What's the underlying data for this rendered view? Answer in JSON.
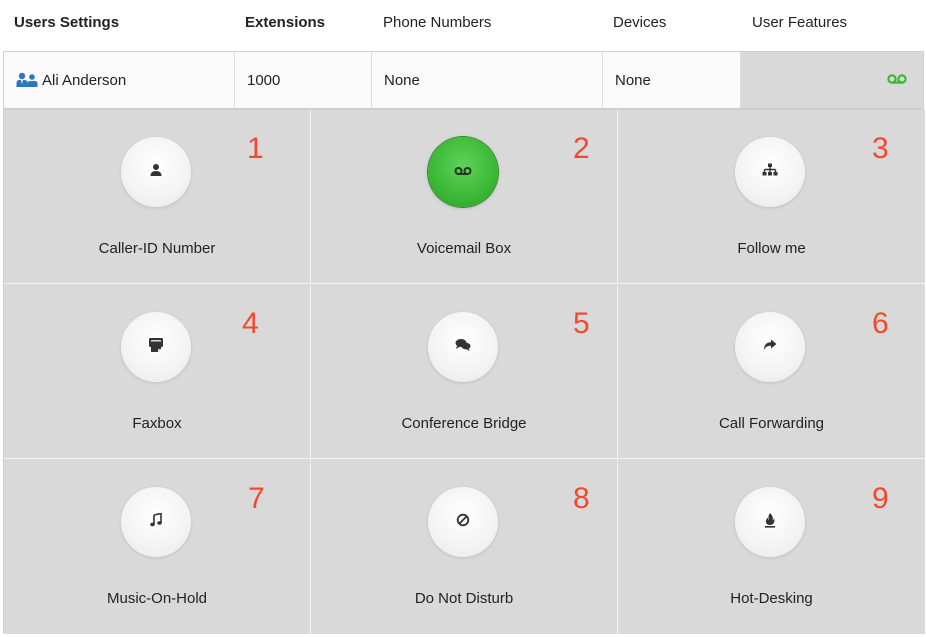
{
  "header": {
    "users_settings": "Users Settings",
    "extensions": "Extensions",
    "phone_numbers": "Phone Numbers",
    "devices": "Devices",
    "user_features": "User Features"
  },
  "user": {
    "name": "Ali Anderson",
    "extension": "1000",
    "phone_numbers": "None",
    "devices": "None",
    "feature_icon": "voicemail-icon",
    "feature_color": "#3cb835"
  },
  "features": [
    {
      "number": "1",
      "label": "Caller-ID Number",
      "icon": "user-icon",
      "active": false
    },
    {
      "number": "2",
      "label": "Voicemail Box",
      "icon": "voicemail-icon",
      "active": true
    },
    {
      "number": "3",
      "label": "Follow me",
      "icon": "sitemap-icon",
      "active": false
    },
    {
      "number": "4",
      "label": "Faxbox",
      "icon": "fax-icon",
      "active": false
    },
    {
      "number": "5",
      "label": "Conference Bridge",
      "icon": "chat-icon",
      "active": false
    },
    {
      "number": "6",
      "label": "Call Forwarding",
      "icon": "forward-icon",
      "active": false
    },
    {
      "number": "7",
      "label": "Music-On-Hold",
      "icon": "music-icon",
      "active": false
    },
    {
      "number": "8",
      "label": "Do Not Disturb",
      "icon": "ban-icon",
      "active": false
    },
    {
      "number": "9",
      "label": "Hot-Desking",
      "icon": "fire-icon",
      "active": false
    }
  ],
  "colors": {
    "active_green": "#3cb835",
    "number_red": "#f04a2e",
    "tile_bg": "#d9d9d9"
  }
}
